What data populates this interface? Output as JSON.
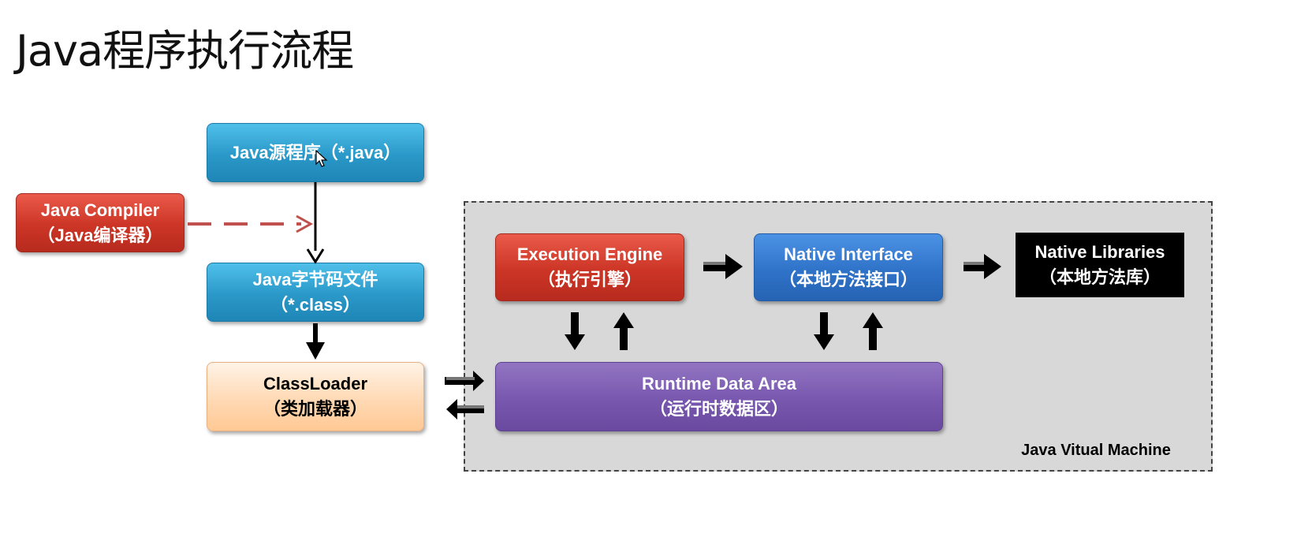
{
  "slide": {
    "title": "Java程序执行流程"
  },
  "boxes": {
    "java_source": {
      "line1": "Java源程序（*.java）"
    },
    "java_compiler": {
      "line1": "Java Compiler",
      "line2": "（Java编译器）"
    },
    "bytecode": {
      "line1": "Java字节码文件",
      "line2": "（*.class）"
    },
    "classloader": {
      "line1": "ClassLoader",
      "line2": "（类加载器）"
    },
    "execution_engine": {
      "line1": "Execution Engine",
      "line2": "（执行引擎）"
    },
    "native_interface": {
      "line1": "Native Interface",
      "line2": "（本地方法接口）"
    },
    "native_libraries": {
      "line1": "Native Libraries",
      "line2": "（本地方法库）"
    },
    "runtime_data_area": {
      "line1": "Runtime Data Area",
      "line2": "（运行时数据区）"
    }
  },
  "jvm_container": {
    "label": "Java Vitual Machine"
  },
  "colors": {
    "blue": "#2a98c8",
    "red": "#cc3526",
    "navy": "#2f73c9",
    "purple": "#7857ae",
    "orange": "#ffd7b0",
    "black": "#000000",
    "jvm_bg": "#d8d8d8",
    "dashed_arrow": "#c0504d"
  }
}
